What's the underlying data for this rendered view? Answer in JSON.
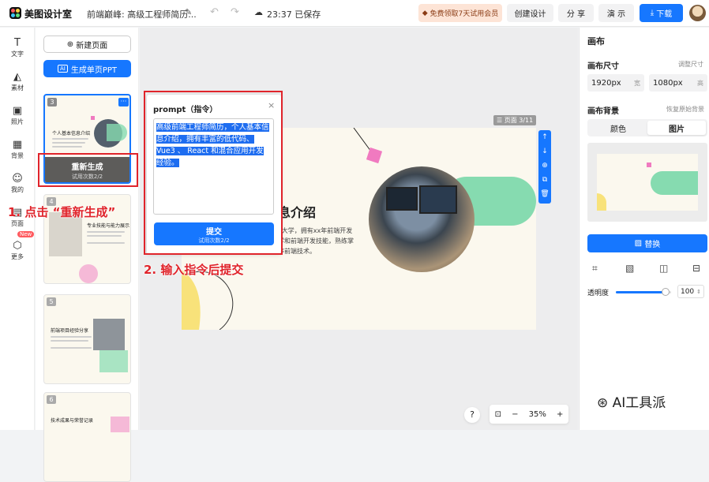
{
  "topbar": {
    "brand": "美图设计室",
    "doc_title": "前端巅峰: 高级工程师简历...",
    "save_status": "23:37 已保存",
    "promo_label": "免费领取7天试用会员",
    "create_label": "创建设计",
    "share_label": "分 享",
    "present_label": "演 示",
    "download_label": "下载"
  },
  "leftnav": [
    {
      "icon": "text-icon",
      "glyph": "T",
      "label": "文字"
    },
    {
      "icon": "element-icon",
      "glyph": "◭",
      "label": "素材"
    },
    {
      "icon": "photo-icon",
      "glyph": "▣",
      "label": "照片"
    },
    {
      "icon": "background-icon",
      "glyph": "▦",
      "label": "背景"
    },
    {
      "icon": "mine-icon",
      "glyph": "☺",
      "label": "我的"
    },
    {
      "icon": "page-icon",
      "glyph": "▤",
      "label": "页面"
    },
    {
      "icon": "more-icon",
      "glyph": "⬡",
      "label": "更多"
    }
  ],
  "leftnav_newtag": "New",
  "pages": {
    "new_page_label": "新建页面",
    "gen_ppt_label": "生成单页PPT",
    "gen_ppt_badge": "AI",
    "thumbs": [
      {
        "num": "3",
        "title": "个人基本信息介绍"
      },
      {
        "num": "4",
        "title": "专业技能与能力展示"
      },
      {
        "num": "5",
        "title": "前端项目经验分享"
      },
      {
        "num": "6",
        "title": "技术成果与荣誉记录"
      }
    ],
    "regen_title": "重新生成",
    "regen_sub": "试用次数2/2"
  },
  "annotations": {
    "step1": "1. 点击 “重新生成”",
    "step2": "2. 输入指令后提交"
  },
  "prompt": {
    "title": "prompt（指令）",
    "text": "高级前端工程师简历，个人基本信息介绍，拥有丰富的低代码、Vue3 、 React 和混合应用开发经验。",
    "submit_label": "提交",
    "submit_sub": "试用次数2/2"
  },
  "slide": {
    "page_tag": "页面 3/11",
    "heading": "息介绍",
    "body_lines": [
      "x大学，拥有xx年前端开发",
      "学和前端开发技能，熟练掌",
      "等前端技术。"
    ]
  },
  "zoom": {
    "value": "35%",
    "minus": "−",
    "plus": "+",
    "help": "?"
  },
  "canvas_panel": {
    "title": "画布",
    "size_label": "画布尺寸",
    "size_link": "调整尺寸",
    "width_value": "1920px",
    "width_unit": "宽",
    "height_value": "1080px",
    "height_unit": "高",
    "bg_label": "画布背景",
    "bg_link": "恢复原始背景",
    "tab_color": "颜色",
    "tab_image": "图片",
    "replace_label": "替换",
    "opacity_label": "透明度",
    "opacity_value": "100",
    "opacity_level": 0.9
  },
  "watermark": "AI工具派",
  "colors": {
    "accent": "#1677ff",
    "red": "#e0242b",
    "green": "#86dbb0",
    "pink": "#f07ac0",
    "yellow": "#f8e27a"
  }
}
